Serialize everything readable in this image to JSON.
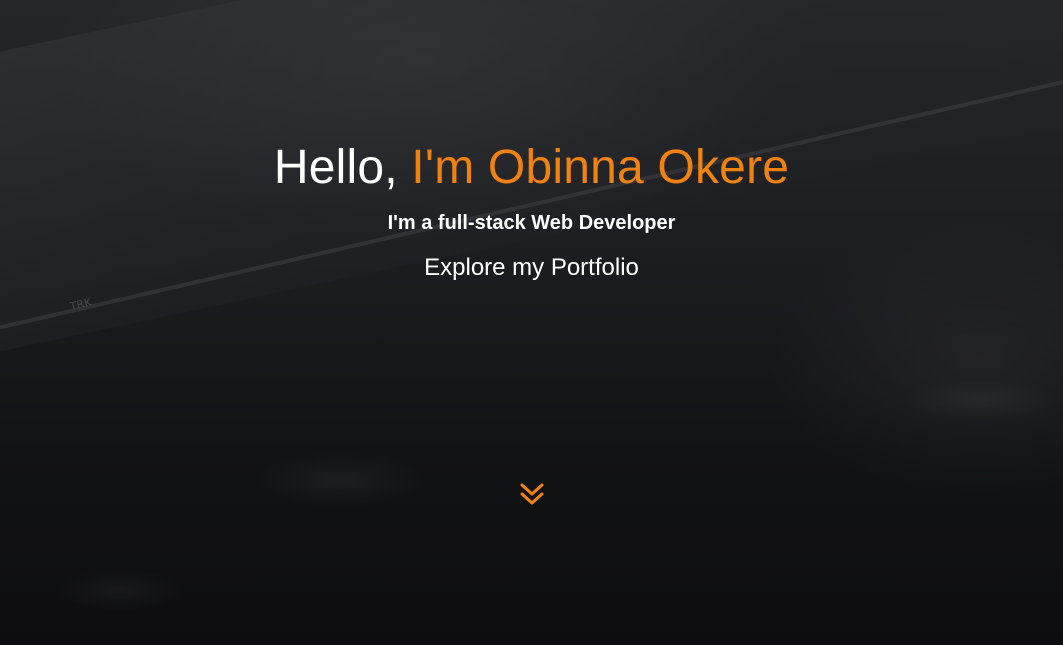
{
  "hero": {
    "greeting": "Hello, ",
    "name": "I'm Obinna Okere",
    "subtitle": "I'm a full-stack Web Developer",
    "explore_label": "Explore my Portfolio",
    "scroll_icon": "chevron-double-down-icon",
    "background_label": "TRK"
  },
  "colors": {
    "accent": "#f0820f",
    "text": "#ffffff",
    "background": "#141517"
  }
}
